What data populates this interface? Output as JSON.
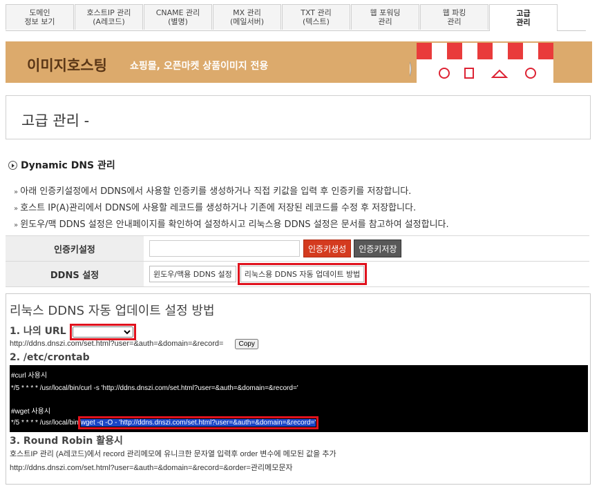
{
  "tabs": [
    {
      "line1": "도메인",
      "line2": "정보 보기",
      "active": false
    },
    {
      "line1": "호스트IP 관리",
      "line2": "(A레코드)",
      "active": false
    },
    {
      "line1": "CNAME 관리",
      "line2": "(별명)",
      "active": false
    },
    {
      "line1": "MX 관리",
      "line2": "(메일서버)",
      "active": false
    },
    {
      "line1": "TXT 관리",
      "line2": "(텍스트)",
      "active": false
    },
    {
      "line1": "웹 포워딩",
      "line2": "관리",
      "active": false
    },
    {
      "line1": "웹 파킹",
      "line2": "관리",
      "active": false
    },
    {
      "line1": "고급",
      "line2": "관리",
      "active": true
    }
  ],
  "banner": {
    "title": "이미지호스팅",
    "subtitle": "쇼핑몰, 오픈마켓 상품이미지 전용"
  },
  "page_title": "고급 관리 -",
  "section": {
    "title": "Dynamic DNS 관리"
  },
  "notes": [
    "아래 인증키설정에서 DDNS에서 사용할 인증키를 생성하거나 직접 키값을 입력 후 인증키를 저장합니다.",
    "호스트 IP(A)관리에서 DDNS에 사용할 레코드를 생성하거나 기존에 저장된 레코드를 수정 후 저장합니다.",
    "윈도우/맥 DDNS 설정은 안내페이지를 확인하여 설정하시고 리눅스용 DDNS 설정은 문서를 참고하여 설정합니다."
  ],
  "form": {
    "auth_label": "인증키설정",
    "auth_value": "",
    "gen_button": "인증키생성",
    "save_button": "인증키저장",
    "ddns_label": "DDNS 설정",
    "win_button": "윈도우/맥용 DDNS 설정",
    "linux_button": "리눅스용 DDNS 자동 업데이트 방법"
  },
  "guide": {
    "title": "리눅스 DDNS 자동 업데이트 설정 방법",
    "h1": "1. 나의 URL",
    "url_line": "http://ddns.dnszi.com/set.html?user=&auth=&domain=&record=",
    "copy_button": "Copy",
    "h2": "2. /etc/crontab",
    "curl_comment": "#curl 사용시",
    "curl_cmd": "*/5 * * * * /usr/local/bin/curl -s 'http://ddns.dnszi.com/set.html?user=&auth=&domain=&record='",
    "wget_comment": "#wget 사용시",
    "wget_prefix": "*/5 * * * * /usr/local/bin/",
    "wget_cmd": "wget -q -O - 'http://ddns.dnszi.com/set.html?user=&auth=&domain=&record='",
    "h3": "3. Round Robin 활용시",
    "rr_desc": "호스트IP 관리 (A레코드)에서 record 관리메모에 유니크한 문자열 입력후 order 변수에 메모된 값을 추가",
    "rr_url": "http://ddns.dnszi.com/set.html?user=&auth=&domain=&record=&order=관리메모문자"
  }
}
